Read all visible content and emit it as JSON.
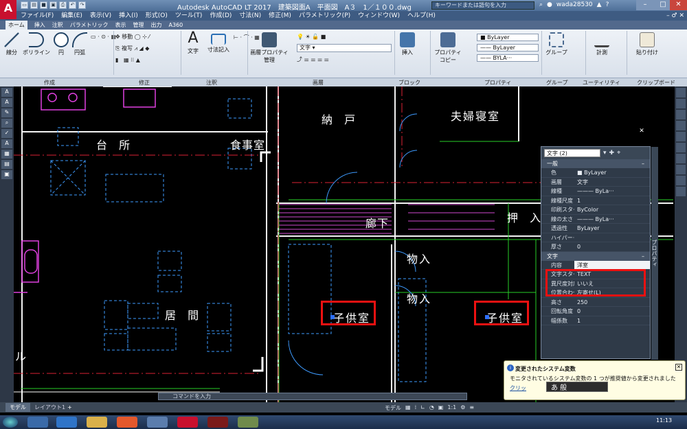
{
  "titlebar": {
    "title": "Autodesk AutoCAD LT 2017　建築図面A　平面図　A３　1／１００.dwg",
    "search_placeholder": "キーワードまたは語句を入力",
    "user": "wada28530",
    "app_logo": "A"
  },
  "menu": [
    "ファイル(F)",
    "編集(E)",
    "表示(V)",
    "挿入(I)",
    "形式(O)",
    "ツール(T)",
    "作成(D)",
    "寸法(N)",
    "修正(M)",
    "パラメトリック(P)",
    "ウィンドウ(W)",
    "ヘルプ(H)"
  ],
  "ribbon_tabs": [
    "ホーム",
    "挿入",
    "注釈",
    "パラメトリック",
    "表示",
    "管理",
    "出力",
    "A360"
  ],
  "ribbon": {
    "line": "線分",
    "polyline": "ポリライン",
    "circle": "円",
    "arc": "円弧",
    "move": "移動",
    "copy": "複写",
    "text": "文字",
    "dimension": "寸法記入",
    "layer_properties_1": "画層プロパティ",
    "layer_properties_2": "管理",
    "layer_current": "文字",
    "insert": "挿入",
    "properties_1": "プロパティ",
    "properties_2": "コピー",
    "bylayer_color": "ByLayer",
    "bylayer_ltype": "ByLayer",
    "bylayer_lweight": "BYLA···",
    "group": "グループ",
    "measure": "計測",
    "paste": "貼り付け",
    "panel_draw": "作成",
    "panel_modify": "修正",
    "panel_annotation": "注釈",
    "panel_layer": "画層",
    "panel_block": "ブロック",
    "panel_properties": "プロパティ",
    "panel_group": "グループ",
    "panel_utility": "ユーティリティ",
    "panel_clipboard": "クリップボード"
  },
  "rooms": {
    "nando": "納 戸",
    "fufu": "夫婦寝室",
    "daidokoro": "台 所",
    "shokuji": "食事室",
    "rouka": "廊下",
    "oshiire": "押 入",
    "monoire_1": "物入",
    "monoire_2": "物入",
    "kodomo_1": "子供室",
    "kodomo_2": "子供室",
    "ima": "居 間",
    "partial_left": "ル"
  },
  "palette": {
    "selection": "文字 (2)",
    "title": "プロパティ",
    "general_header": "一般",
    "text_header": "文字",
    "general": [
      {
        "k": "色",
        "v": "■ ByLayer"
      },
      {
        "k": "画層",
        "v": "文字"
      },
      {
        "k": "線種",
        "v": "——— ByLa···"
      },
      {
        "k": "線種尺度",
        "v": "1"
      },
      {
        "k": "印刷スタ···",
        "v": "ByColor"
      },
      {
        "k": "線の太さ",
        "v": "——— ByLa···"
      },
      {
        "k": "透過性",
        "v": "ByLayer"
      },
      {
        "k": "ハイパー···",
        "v": ""
      },
      {
        "k": "厚さ",
        "v": "0"
      }
    ],
    "text": [
      {
        "k": "内容",
        "v": "洋室"
      },
      {
        "k": "文字スタ···",
        "v": "TEXT"
      },
      {
        "k": "異尺度対応",
        "v": "いいえ"
      },
      {
        "k": "位置合わせ",
        "v": "左寄せ(L)"
      },
      {
        "k": "高さ",
        "v": "250"
      },
      {
        "k": "回転角度",
        "v": "0"
      },
      {
        "k": "幅係数",
        "v": "1"
      }
    ]
  },
  "balloon": {
    "title": "変更されたシステム変数",
    "message": "モニタされているシステム変数の 1 つが推奨値から変更されました",
    "link": "クリッ"
  },
  "ime": "あ 般",
  "command_placeholder": "コマンドを入力",
  "layout_tabs": {
    "model": "モデル",
    "layout1": "レイアウト1",
    "add": "+"
  },
  "status": {
    "model": "モデル",
    "scale": "1:1"
  },
  "clock": "11:13"
}
